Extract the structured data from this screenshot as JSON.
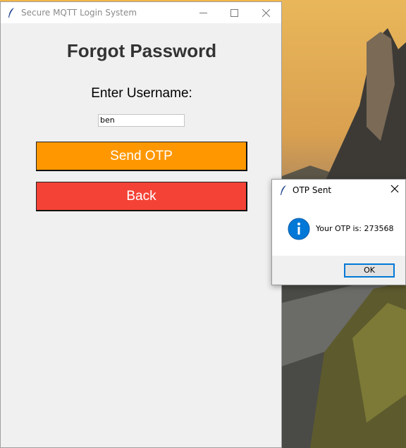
{
  "main_window": {
    "title": "Secure MQTT Login System",
    "heading": "Forgot Password",
    "username_label": "Enter Username:",
    "username_value": "ben",
    "send_otp_label": "Send OTP",
    "back_label": "Back"
  },
  "dialog": {
    "title": "OTP Sent",
    "message": "Your OTP is: 273568",
    "ok_label": "OK",
    "icon": "info-icon"
  },
  "colors": {
    "send_button": "#ff9800",
    "back_button": "#f44336",
    "info_icon": "#0078d7"
  }
}
